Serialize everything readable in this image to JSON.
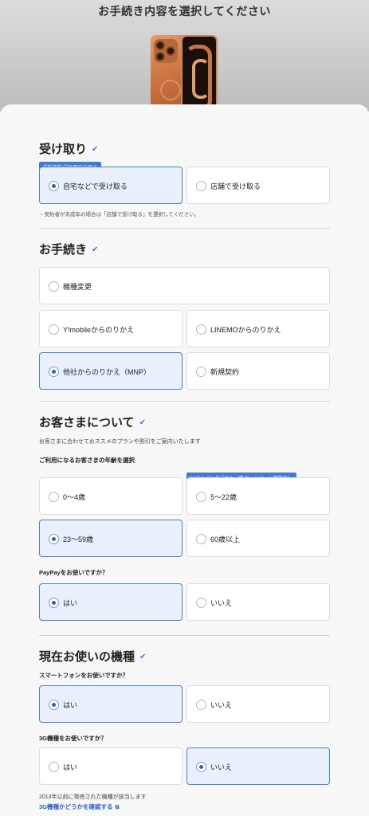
{
  "header": {
    "title": "お手続き内容を選択してください"
  },
  "receive": {
    "title": "受け取り",
    "badge": "送料無料/最短翌日お届け",
    "options": [
      "自宅などで受け取る",
      "店舗で受け取る"
    ],
    "selected": 0,
    "note": "・契約者が未成年の場合は「店舗で受け取る」を選択してください。"
  },
  "procedure": {
    "title": "お手続き",
    "options": [
      "機種変更",
      "Y!mobileからのりかえ",
      "LINEMOからのりかえ",
      "他社からのりかえ（MNP）",
      "新規契約"
    ],
    "selected": 3
  },
  "customer": {
    "title": "お客さまについて",
    "description": "お客さまに合わせておススメのプランや割引をご案内いたします",
    "age_question": "ご利用になるお客さまの年齢を選択",
    "age_badge": "ソフトバンクデビュー割 キャンペーン実施中！",
    "age_options": [
      "0〜4歳",
      "5〜22歳",
      "23〜59歳",
      "60歳以上"
    ],
    "age_selected": 2,
    "paypay_question": "PayPayをお使いですか？",
    "paypay_options": [
      "はい",
      "いいえ"
    ],
    "paypay_selected": 0
  },
  "device": {
    "title": "現在お使いの機種",
    "smartphone_question": "スマートフォンをお使いですか？",
    "smartphone_options": [
      "はい",
      "いいえ"
    ],
    "smartphone_selected": 0,
    "g3_question": "3G機種をお使いですか？",
    "g3_options": [
      "はい",
      "いいえ"
    ],
    "g3_selected": 1,
    "g3_note": "2013年以前に発売された機種が該当します",
    "g3_link": "3G機種かどうかを確認する"
  },
  "colors": {
    "accent": "#3f7ad6",
    "selected_bg": "#eaf0fb",
    "selected_border": "#4e7fd4"
  },
  "icons": {
    "check": "check-icon",
    "external": "external-link-icon"
  }
}
